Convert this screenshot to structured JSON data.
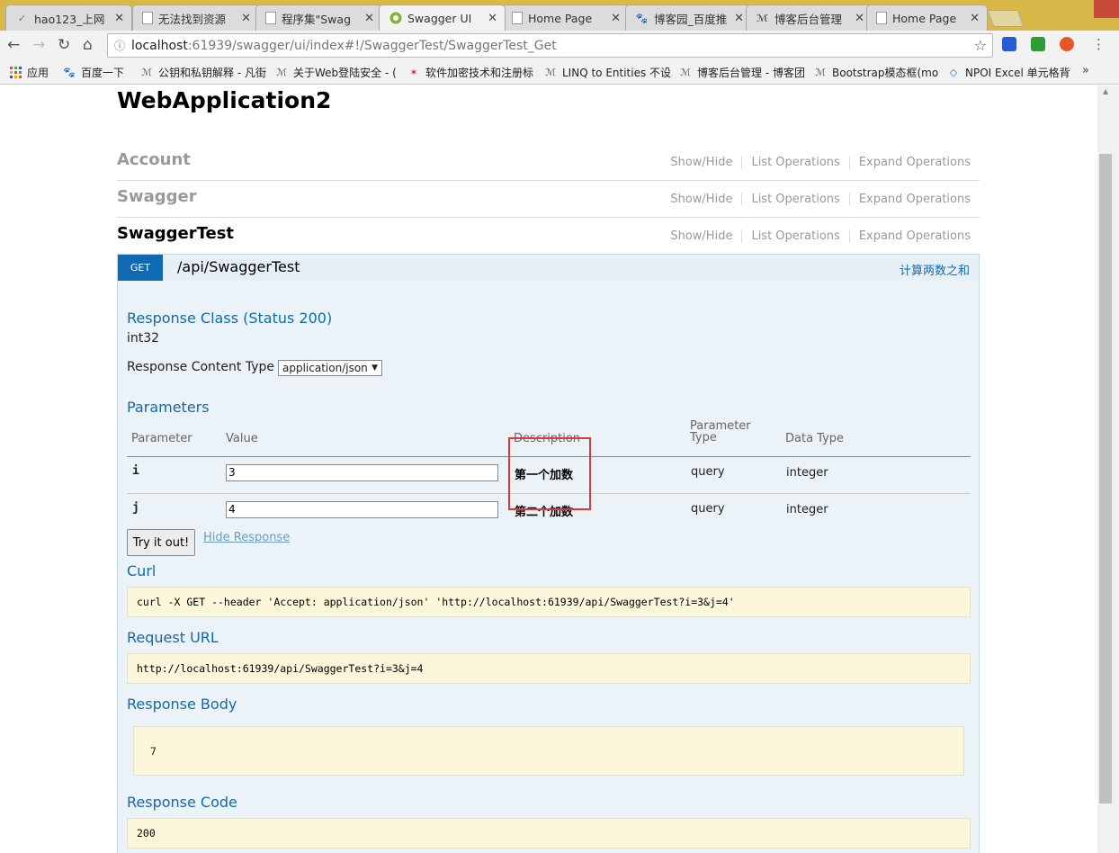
{
  "browser": {
    "tabs": [
      {
        "title": "hao123_上网",
        "active": false
      },
      {
        "title": "无法找到资源",
        "active": false
      },
      {
        "title": "程序集\"Swag",
        "active": false
      },
      {
        "title": "Swagger UI",
        "active": true
      },
      {
        "title": "Home Page",
        "active": false
      },
      {
        "title": "博客园_百度推",
        "active": false
      },
      {
        "title": "博客后台管理",
        "active": false
      },
      {
        "title": "Home Page",
        "active": false
      }
    ],
    "url_host": "localhost",
    "url_rest": ":61939/swagger/ui/index#!/SwaggerTest/SwaggerTest_Get",
    "bookmarks": [
      "应用",
      "百度一下",
      "公钥和私钥解释 - 凡街",
      "关于Web登陆安全 - (",
      "软件加密技术和注册标",
      "LINQ to Entities 不设",
      "博客后台管理 - 博客团",
      "Bootstrap模态框(mo",
      "NPOI Excel 单元格背"
    ],
    "bookmarks_more": "»"
  },
  "page": {
    "title": "WebApplication2",
    "resources": [
      {
        "name": "Account",
        "active": false
      },
      {
        "name": "Swagger",
        "active": false
      },
      {
        "name": "SwaggerTest",
        "active": true
      }
    ],
    "ops_labels": {
      "show_hide": "Show/Hide",
      "list": "List Operations",
      "expand": "Expand Operations"
    },
    "operation": {
      "method": "GET",
      "path": "/api/SwaggerTest",
      "summary": "计算两数之和"
    },
    "response_class_heading": "Response Class (Status 200)",
    "response_class_type": "int32",
    "response_content_type_label": "Response Content Type",
    "response_content_type_value": "application/json",
    "parameters_heading": "Parameters",
    "param_headers": {
      "parameter": "Parameter",
      "value": "Value",
      "description": "Description",
      "parameter_type_1": "Parameter",
      "parameter_type_2": "Type",
      "data_type": "Data Type"
    },
    "params": [
      {
        "name": "i",
        "value": "3",
        "description": "第一个加数",
        "type": "query",
        "data_type": "integer"
      },
      {
        "name": "j",
        "value": "4",
        "description": "第二个加数",
        "type": "query",
        "data_type": "integer"
      }
    ],
    "try_button": "Try it out!",
    "hide_response": "Hide Response",
    "curl_heading": "Curl",
    "curl_command": "curl -X GET --header 'Accept: application/json' 'http://localhost:61939/api/SwaggerTest?i=3&j=4'",
    "request_url_heading": "Request URL",
    "request_url": "http://localhost:61939/api/SwaggerTest?i=3&j=4",
    "response_body_heading": "Response Body",
    "response_body": "7",
    "response_code_heading": "Response Code",
    "response_code": "200"
  },
  "colors": {
    "accent": "#0f6ab4",
    "highlight_box": "#d93a3a",
    "code_background": "#fcf6db",
    "operation_background": "#ebf3f9"
  },
  "icons": {
    "back": "arrow-left-icon",
    "forward": "arrow-right-icon",
    "reload": "reload-icon",
    "home": "home-icon",
    "bookmark_star": "star-icon",
    "menu": "kebab-menu-icon"
  }
}
